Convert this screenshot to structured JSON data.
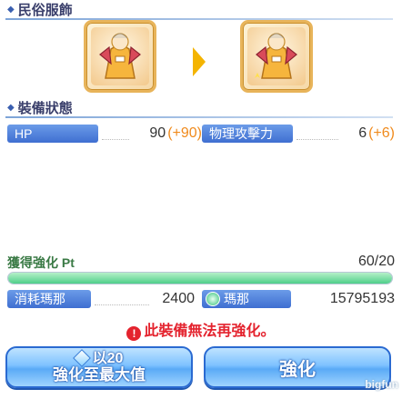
{
  "sections": {
    "costume_title": "民俗服飾",
    "status_title": "裝備狀態"
  },
  "stats": {
    "hp_label": "HP",
    "hp_value": "90",
    "hp_bonus": "(+90)",
    "atk_label": "物理攻擊力",
    "atk_value": "6",
    "atk_bonus": "(+6)"
  },
  "enhance": {
    "pt_label": "獲得強化 Pt",
    "pt_value": "60/20",
    "pt_fill": 1.0,
    "mana_label": "消耗瑪那",
    "mana_cost": "2400",
    "owned_label": "瑪那",
    "owned_value": "15795193",
    "warning": "此裝備無法再強化。"
  },
  "buttons": {
    "max_badge": "以20",
    "max_label": "強化至最大值",
    "enhance_label": "強化"
  },
  "watermark": "bigfun"
}
